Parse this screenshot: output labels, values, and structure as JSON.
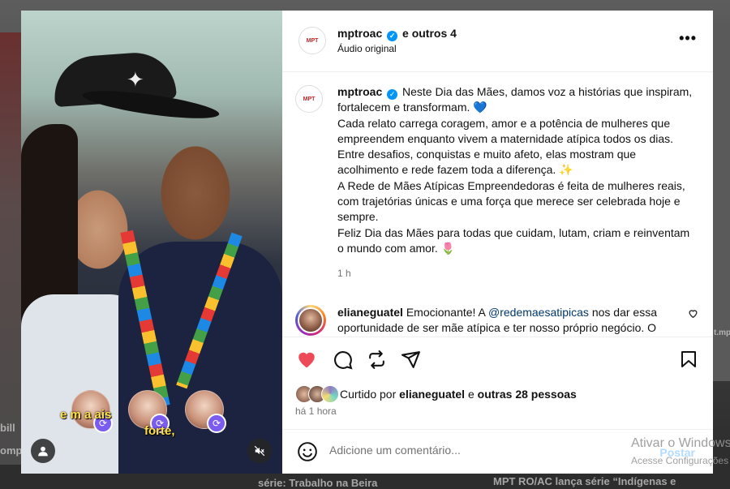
{
  "post": {
    "header": {
      "username": "mptroac",
      "collab_suffix": "e outros 4",
      "audio": "Áudio original",
      "more": "•••"
    },
    "caption": {
      "username": "mptroac",
      "lines": [
        "Neste Dia das Mães, damos voz a histórias que inspiram, fortalecem e transformam. 💙",
        "Cada relato carrega coragem, amor e a potência de mulheres que empreendem enquanto vivem a maternidade atípica todos os dias. Entre desafios, conquistas e muito afeto, elas mostram que acolhimento e rede fazem toda a diferença. ✨",
        "A Rede de Mães Atípicas Empreendedoras é feita de mulheres reais, com trajetórias únicas e uma força que merece ser celebrada hoje e sempre.",
        "Feliz Dia das Mães para todas que cuidam, lutam, criam e reinventam o mundo com amor. 🌷"
      ],
      "time": "1 h"
    },
    "comment": {
      "username": "elianeguatel",
      "text_before": "Emocionante! A",
      "mention": "@redemaesatipicas",
      "text_after": "nos dar essa oportunidade de ser mãe atípica e ter nosso próprio negócio. O empreendedorismo vai muito além de gerar renda"
    },
    "likes": {
      "prefix": "Curtido por",
      "user": "elianeguatel",
      "connector": "e",
      "others": "outras 28 pessoas"
    },
    "time_ago": "há 1 hora",
    "comment_input": {
      "placeholder": "Adicione um comentário..."
    },
    "post_button": "Postar",
    "media_caption": {
      "line1": "e    m       a           ais",
      "line2": "forte,"
    },
    "avatar_logo_text": "MPT"
  },
  "background": {
    "left_text_1": "bill",
    "left_text_2": "omp",
    "bottom_text_1": "série: Trabalho na Beira",
    "bottom_text_2": "MPT RO/AC lança série “Indígenas e",
    "right_text": "t.mp"
  },
  "watermark": {
    "line1": "Ativar o Windows",
    "line2": "Acesse Configurações"
  },
  "colors": {
    "like": "#ed4956",
    "verified": "#0095f6",
    "mention": "#00376b",
    "post_disabled": "#b3dbff"
  }
}
